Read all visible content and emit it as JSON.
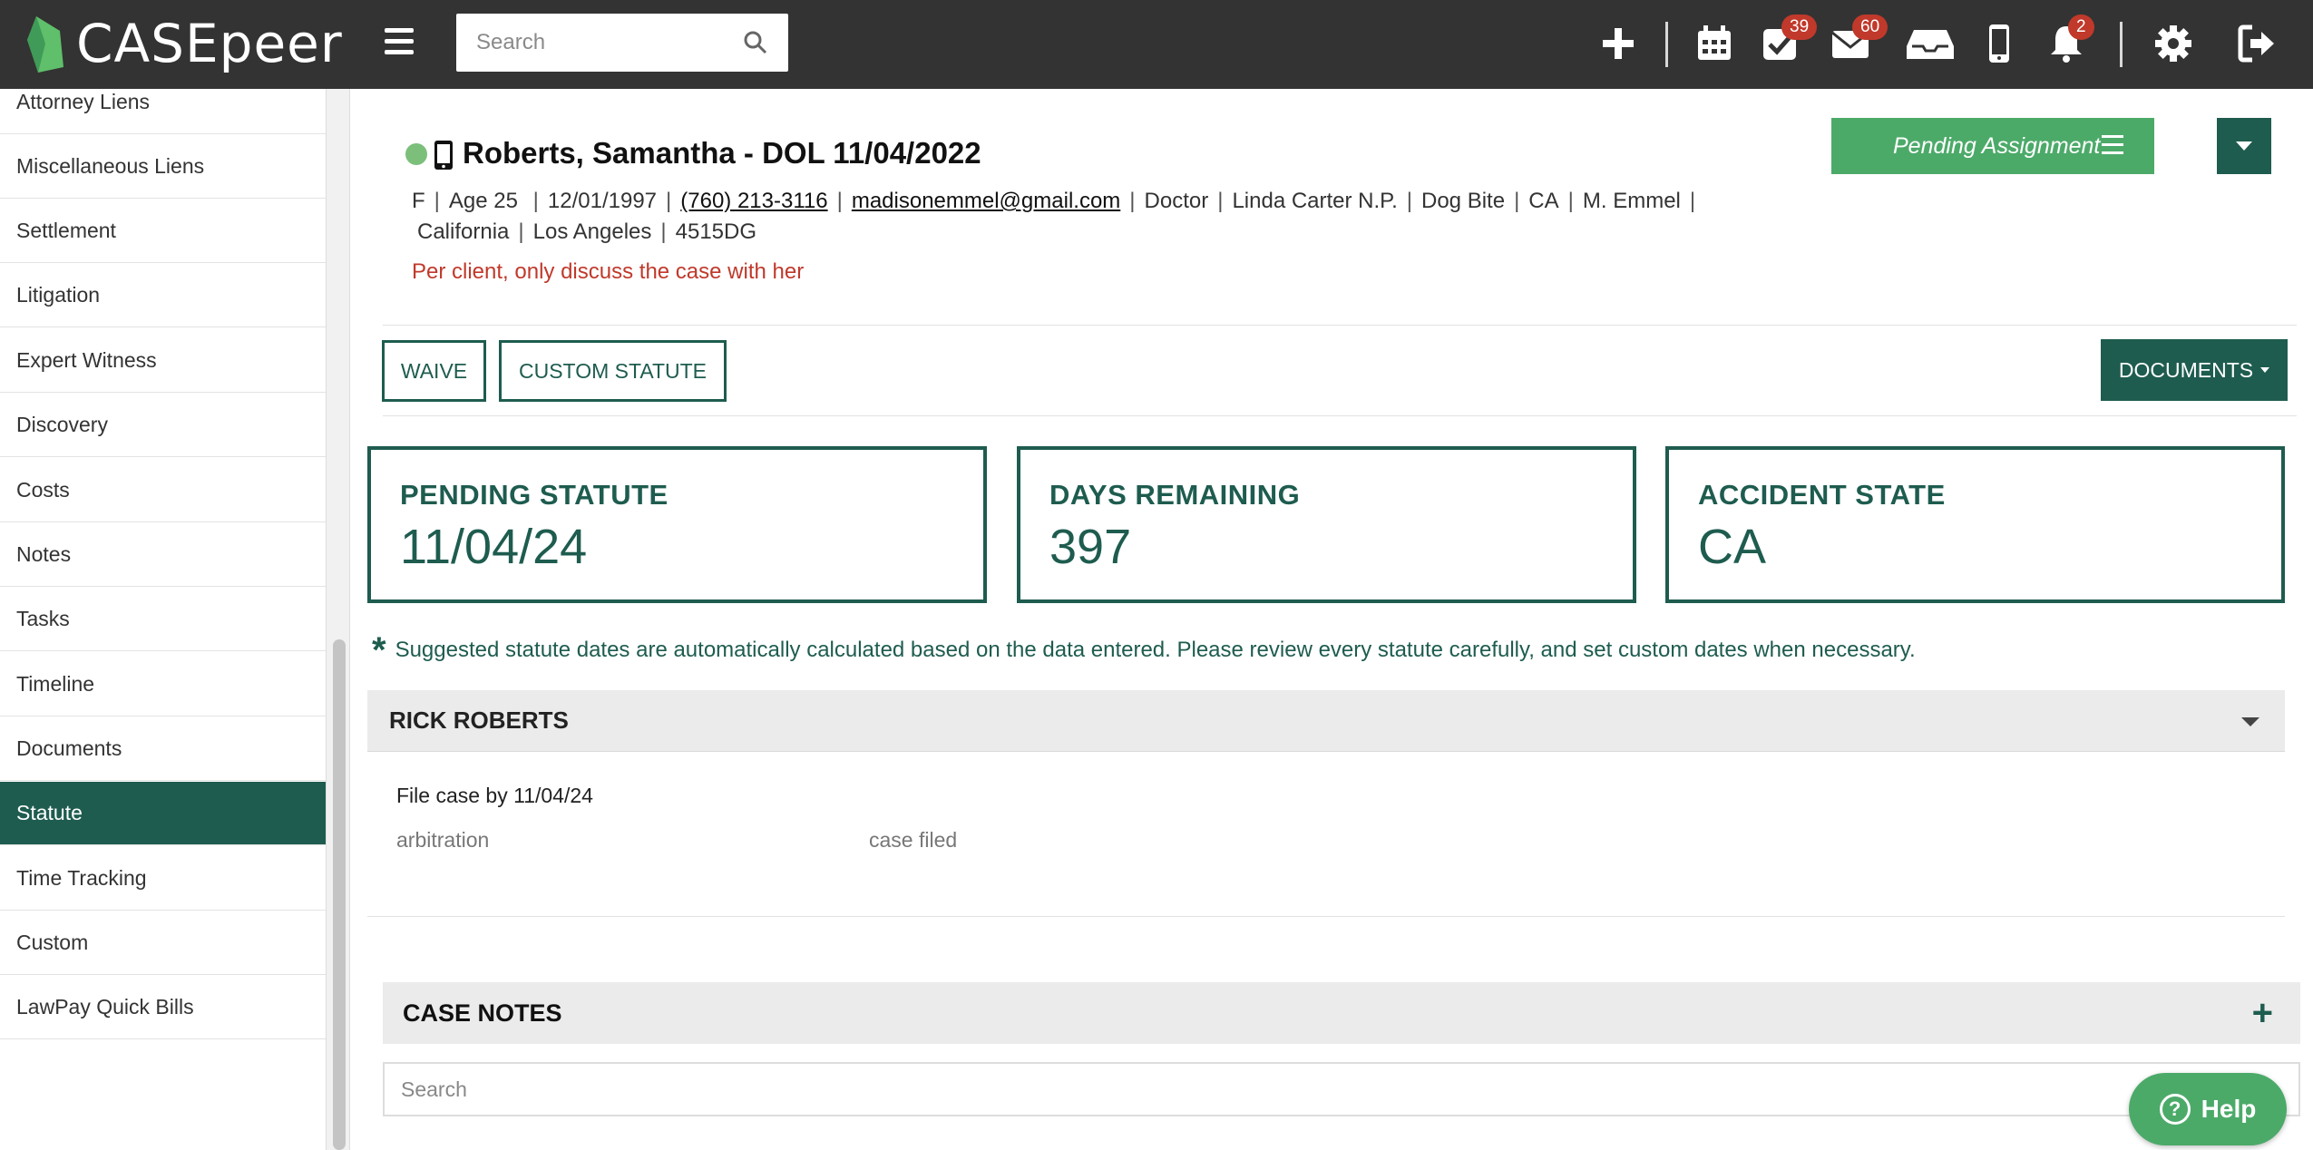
{
  "header": {
    "logo_text": "CASEpeer",
    "search_placeholder": "Search",
    "badges": {
      "tasks": "39",
      "mail": "60",
      "notifications": "2"
    },
    "accent_color": "#1e5c4f",
    "pending_color": "#4caa69",
    "alert_color": "#c0392b"
  },
  "sidebar": {
    "items": [
      {
        "label": "Attorney Liens"
      },
      {
        "label": "Miscellaneous Liens"
      },
      {
        "label": "Settlement"
      },
      {
        "label": "Litigation"
      },
      {
        "label": "Expert Witness"
      },
      {
        "label": "Discovery"
      },
      {
        "label": "Costs"
      },
      {
        "label": "Notes"
      },
      {
        "label": "Tasks"
      },
      {
        "label": "Timeline"
      },
      {
        "label": "Documents"
      },
      {
        "label": "Statute"
      },
      {
        "label": "Time Tracking"
      },
      {
        "label": "Custom"
      },
      {
        "label": "LawPay Quick Bills"
      }
    ],
    "active_item": "Statute"
  },
  "case": {
    "title": "Roberts, Samantha - DOL 11/04/2022",
    "gender": "F",
    "age": "Age 25",
    "dob": "12/01/1997",
    "phone": "(760) 213-3116",
    "email": "madisonemmel@gmail.com",
    "role": "Doctor",
    "provider": "Linda Carter N.P.",
    "case_type": "Dog Bite",
    "state": "CA",
    "attorney": "M. Emmel",
    "location_state": "California",
    "location_city": "Los Angeles",
    "case_code": "4515DG",
    "note": "Per client, only discuss the case with her",
    "status_label": "Pending Assignment"
  },
  "actions": {
    "waive": "WAIVE",
    "custom_statute": "CUSTOM STATUTE",
    "documents": "DOCUMENTS"
  },
  "stats": [
    {
      "label": "PENDING STATUTE",
      "value": "11/04/24"
    },
    {
      "label": "DAYS REMAINING",
      "value": "397"
    },
    {
      "label": "ACCIDENT STATE",
      "value": "CA"
    }
  ],
  "disclaimer": "Suggested statute dates are automatically calculated based on the data entered. Please review every statute carefully, and set custom dates when necessary.",
  "party": {
    "name": "RICK ROBERTS",
    "file_by": "File case by 11/04/24",
    "meta_left": "arbitration",
    "meta_right": "case filed"
  },
  "case_notes": {
    "title": "CASE NOTES",
    "search_placeholder": "Search"
  },
  "help": {
    "label": "Help"
  }
}
